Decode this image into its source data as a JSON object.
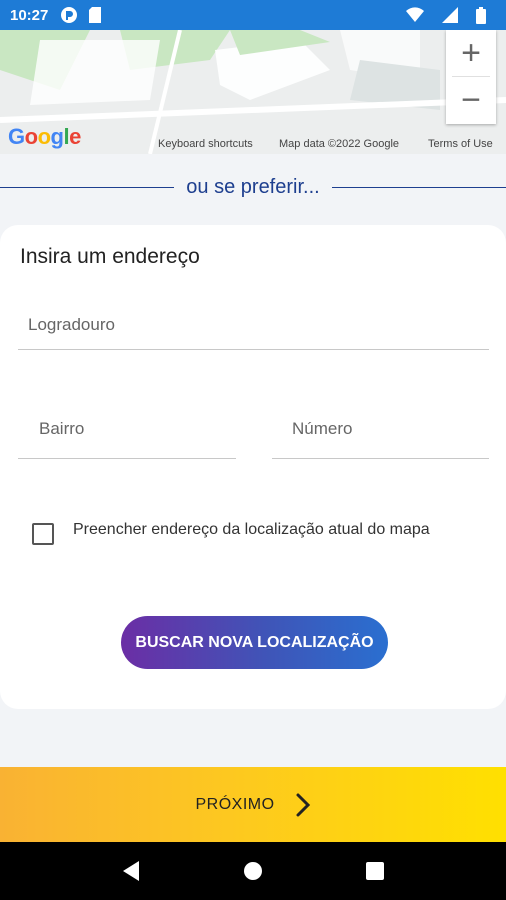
{
  "status_bar": {
    "time": "10:27",
    "icons": [
      "cast-icon",
      "sd-card-icon",
      "wifi-icon",
      "signal-icon",
      "battery-icon"
    ]
  },
  "map": {
    "logo_letters": [
      "G",
      "o",
      "o",
      "g",
      "l",
      "e"
    ],
    "logo_colors": [
      "#4285F4",
      "#EA4335",
      "#FBBC05",
      "#4285F4",
      "#34A853",
      "#EA4335"
    ],
    "keyboard_shortcuts": "Keyboard shortcuts",
    "map_data": "Map data ©2022 Google",
    "terms": "Terms of Use",
    "zoom_in": "+",
    "zoom_out": "−"
  },
  "divider": {
    "text": "ou se preferir..."
  },
  "form": {
    "title": "Insira um endereço",
    "street_placeholder": "Logradouro",
    "neighborhood_placeholder": "Bairro",
    "number_placeholder": "Número",
    "use_location_label": "Preencher endereço da localização atual do mapa",
    "use_location_checked": false,
    "search_button": "BUSCAR NOVA LOCALIZAÇÃO"
  },
  "footer": {
    "next_label": "PRÓXIMO"
  },
  "colors": {
    "status_bar": "#1e7bd6",
    "accent_blue": "#1e3f8f",
    "button_gradient_start": "#6b2ea5",
    "button_gradient_end": "#2a6fd0",
    "next_gradient_start": "#f9b233",
    "next_gradient_end": "#ffe000"
  }
}
